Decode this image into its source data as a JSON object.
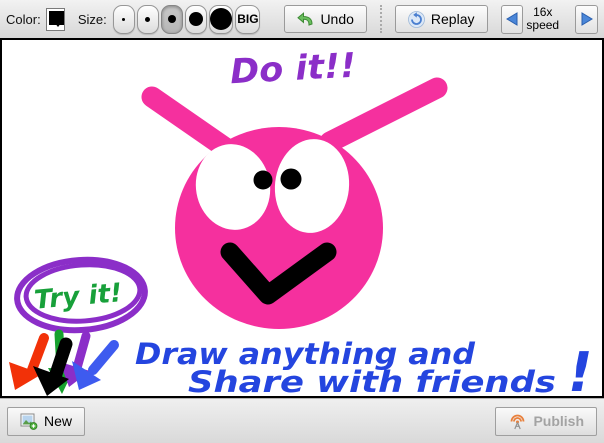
{
  "toolbar": {
    "color_label": "Color:",
    "size_label": "Size:",
    "big_label": "BIG",
    "undo_label": "Undo",
    "replay_label": "Replay",
    "speed": {
      "value": "16x",
      "label": "speed"
    },
    "selected_size_index": 2,
    "icons": {
      "color_swatch": "black-color-swatch with dropdown-arrow",
      "undo": "green-curved-arrow",
      "replay": "blue-circular-arrow",
      "speed_prev": "blue-left-triangle",
      "speed_next": "blue-right-triangle"
    }
  },
  "canvas": {
    "texts": {
      "do_it": "Do it!!",
      "try_it": "Try it!",
      "tagline_line1": "Draw anything and",
      "tagline_line2": "Share with friends",
      "tagline_exclaim": "!"
    },
    "doodle_arrows": [
      "red",
      "black",
      "green",
      "purple",
      "blue"
    ],
    "colors": {
      "pink": "#f5309e",
      "purple": "#8b2ec8",
      "green": "#18a03a",
      "blue": "#2445df",
      "black": "#000000",
      "white": "#ffffff",
      "arrow_red": "#f23108",
      "arrow_black": "#000000",
      "arrow_green": "#17a12e",
      "arrow_purple": "#8b2ec8",
      "arrow_blue": "#3e5bef"
    }
  },
  "footer": {
    "new_label": "New",
    "publish_label": "Publish",
    "icons": {
      "new": "picture-with-green-plus",
      "publish": "orange-broadcast-antenna"
    }
  }
}
